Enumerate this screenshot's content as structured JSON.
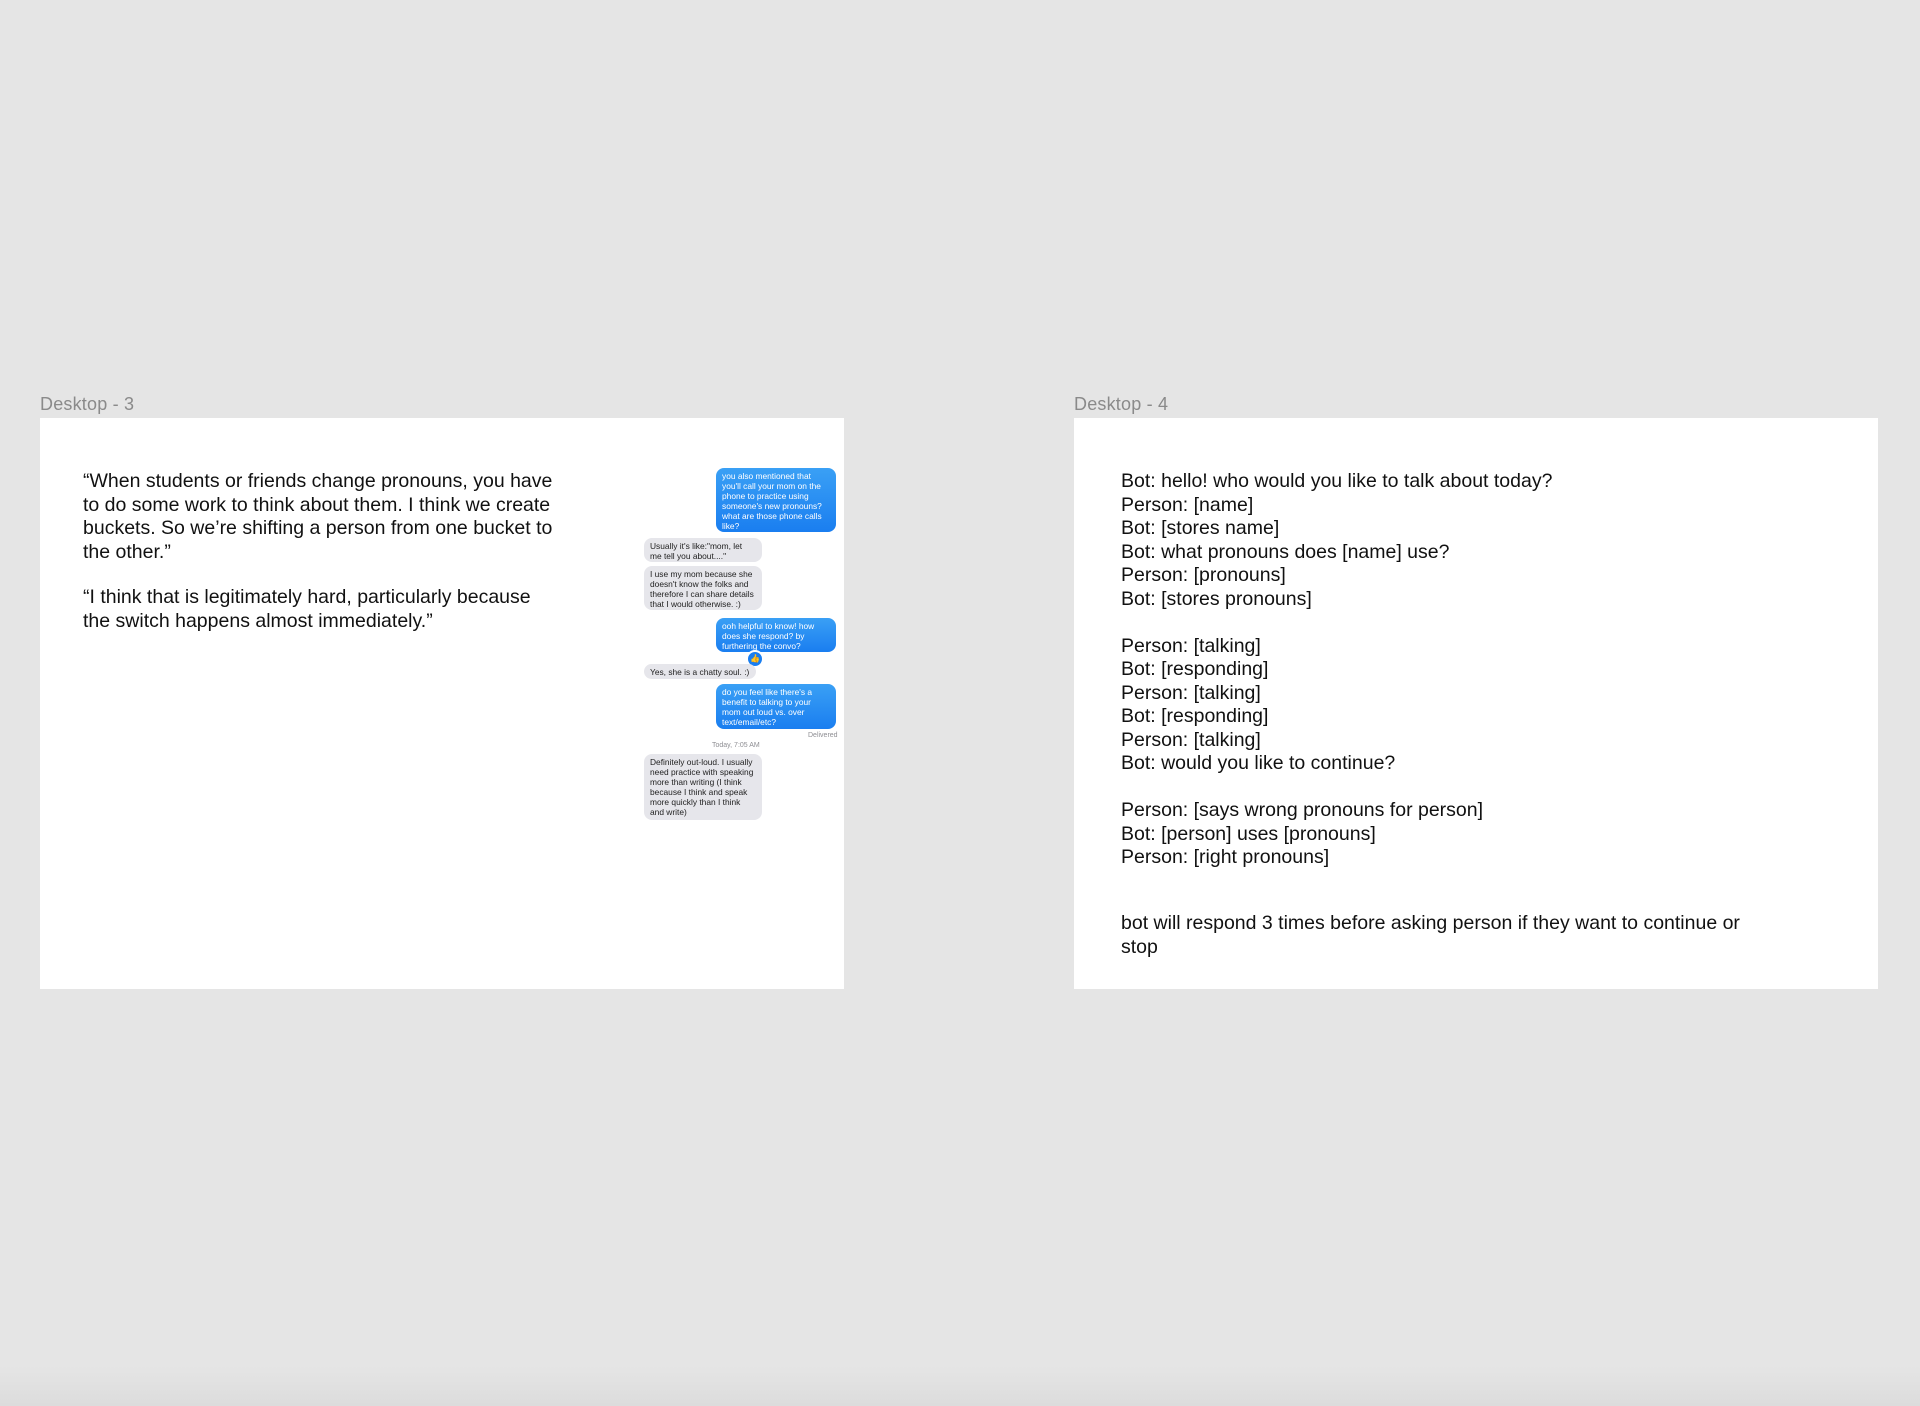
{
  "frames": {
    "desktop3": {
      "label": "Desktop - 3",
      "quotes": [
        "“When students or friends change pronouns, you have to do some work to think about them. I think we create buckets. So we’re shifting a person from one bucket to the other.”",
        "“I think that is legitimately hard, particularly because the switch happens almost immediately.”"
      ],
      "chat": {
        "messages": [
          {
            "from": "me",
            "text": "you also mentioned that you'll call your mom on the phone to practice using someone's new pronouns? what are those phone calls like?"
          },
          {
            "from": "them",
            "text": "Usually it's like:\"mom, let me tell you about....\""
          },
          {
            "from": "them",
            "text": "I use my mom because she doesn't know the folks and therefore I can share details that I would otherwise. :)"
          },
          {
            "from": "me",
            "text": "ooh helpful to know! how does she respond? by furthering the convo?"
          },
          {
            "from": "them",
            "text": "Yes, she is a chatty soul. :)"
          },
          {
            "from": "me",
            "text": "do you feel like there's a benefit to talking to your mom out loud vs. over text/email/etc?"
          },
          {
            "from": "them",
            "text": "Definitely out-loud. I usually need practice with speaking more than writing (I think because I think and speak more quickly than I think and write)"
          }
        ],
        "reaction_icon": "thumbs-up-icon",
        "reaction_glyph": "👍",
        "delivered_label": "Delivered",
        "timestamp": "Today, 7:05 AM"
      }
    },
    "desktop4": {
      "label": "Desktop - 4",
      "script_block_1": [
        "Bot: hello! who would you like to talk about today?",
        "Person: [name]",
        "Bot: [stores name]",
        "Bot: what pronouns does [name] use?",
        "Person: [pronouns]",
        "Bot: [stores pronouns]"
      ],
      "script_block_2": [
        "Person: [talking]",
        "Bot: [responding]",
        "Person: [talking]",
        "Bot: [responding]",
        "Person: [talking]",
        "Bot: would you like to continue?"
      ],
      "script_block_3": [
        "Person: [says wrong pronouns for person]",
        "Bot: [person] uses [pronouns]",
        "Person: [right pronouns]"
      ],
      "note": "bot will respond 3 times before asking person if they want to continue or stop"
    }
  }
}
